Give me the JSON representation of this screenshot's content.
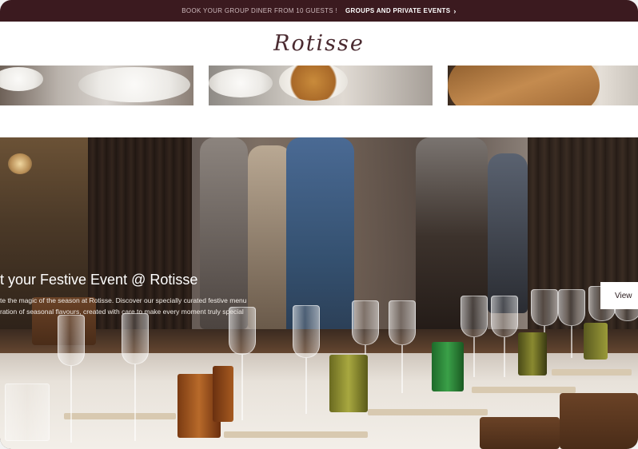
{
  "promo_bar": {
    "text": "BOOK YOUR GROUP DINER FROM 10 GUESTS !",
    "link_label": "GROUPS AND PRIVATE EVENTS",
    "link_icon": "chevron-right-icon",
    "background": "#3b1a1f"
  },
  "header": {
    "logo_text": "Rotisse",
    "logo_color": "#4a2a30"
  },
  "hero": {
    "title": "t your Festive Event @ Rotisse",
    "text_line1": "te the magic of the season at Rotisse. Discover our specially curated festive menu",
    "text_line2": "ration of seasonal flavours, created with care to make every moment truly special",
    "cta_label": "View"
  }
}
